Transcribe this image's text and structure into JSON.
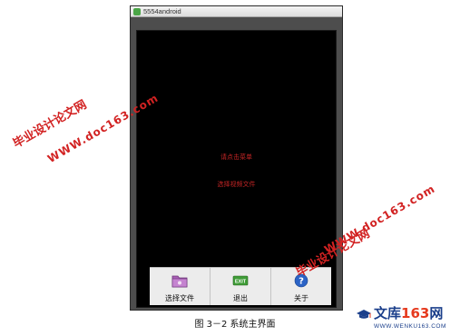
{
  "window": {
    "title": "5554android"
  },
  "screen": {
    "prompt_primary": "请点击菜单",
    "prompt_secondary": "选择视频文件"
  },
  "options_menu": {
    "items": [
      {
        "label": "选择文件",
        "icon": "folder-icon",
        "icon_color": "#a85fb6"
      },
      {
        "label": "退出",
        "icon": "exit-icon",
        "icon_text": "EXIT",
        "icon_color": "#3f9c37"
      },
      {
        "label": "关于",
        "icon": "help-icon",
        "icon_text": "?",
        "icon_color": "#2b63c6"
      }
    ]
  },
  "caption": "图 3－2 系统主界面",
  "watermarks": {
    "site_name": "毕业设计论文网",
    "site_url": "WWW.doc163.com"
  },
  "logo": {
    "brand_cn": "文库",
    "brand_num": "163",
    "brand_net": "网",
    "url": "WWW.WENKU163.COM"
  },
  "colors": {
    "prompt_text": "#c42525",
    "watermark": "#d22222",
    "logo_blue": "#1b3f8b",
    "logo_red": "#e63a1e"
  }
}
